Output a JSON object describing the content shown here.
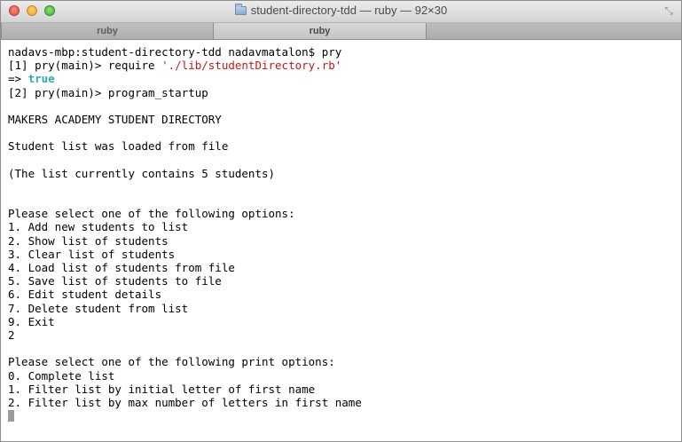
{
  "window": {
    "title": "student-directory-tdd — ruby — 92×30",
    "tabs": [
      {
        "label": "ruby"
      },
      {
        "label": "ruby"
      }
    ]
  },
  "terminal": {
    "lines": [
      {
        "parts": [
          {
            "text": "nadavs-mbp:student-directory-tdd nadavmatalon$ pry",
            "style": "normal"
          }
        ]
      },
      {
        "parts": [
          {
            "text": "[1] pry(main)> require ",
            "style": "normal"
          },
          {
            "text": "'./lib/studentDirectory.rb'",
            "style": "string"
          }
        ]
      },
      {
        "parts": [
          {
            "text": "=> ",
            "style": "normal"
          },
          {
            "text": "true",
            "style": "bool"
          }
        ]
      },
      {
        "parts": [
          {
            "text": "[2] pry(main)> program_startup",
            "style": "normal"
          }
        ]
      },
      {
        "parts": [
          {
            "text": "",
            "style": "normal"
          }
        ]
      },
      {
        "parts": [
          {
            "text": "MAKERS ACADEMY STUDENT DIRECTORY",
            "style": "normal"
          }
        ]
      },
      {
        "parts": [
          {
            "text": "",
            "style": "normal"
          }
        ]
      },
      {
        "parts": [
          {
            "text": "Student list was loaded from file",
            "style": "normal"
          }
        ]
      },
      {
        "parts": [
          {
            "text": "",
            "style": "normal"
          }
        ]
      },
      {
        "parts": [
          {
            "text": "(The list currently contains 5 students)",
            "style": "normal"
          }
        ]
      },
      {
        "parts": [
          {
            "text": "",
            "style": "normal"
          }
        ]
      },
      {
        "parts": [
          {
            "text": "",
            "style": "normal"
          }
        ]
      },
      {
        "parts": [
          {
            "text": "Please select one of the following options:",
            "style": "normal"
          }
        ]
      },
      {
        "parts": [
          {
            "text": "1. Add new students to list",
            "style": "normal"
          }
        ]
      },
      {
        "parts": [
          {
            "text": "2. Show list of students",
            "style": "normal"
          }
        ]
      },
      {
        "parts": [
          {
            "text": "3. Clear list of students",
            "style": "normal"
          }
        ]
      },
      {
        "parts": [
          {
            "text": "4. Load list of students from file",
            "style": "normal"
          }
        ]
      },
      {
        "parts": [
          {
            "text": "5. Save list of students to file",
            "style": "normal"
          }
        ]
      },
      {
        "parts": [
          {
            "text": "6. Edit student details",
            "style": "normal"
          }
        ]
      },
      {
        "parts": [
          {
            "text": "7. Delete student from list",
            "style": "normal"
          }
        ]
      },
      {
        "parts": [
          {
            "text": "9. Exit",
            "style": "normal"
          }
        ]
      },
      {
        "parts": [
          {
            "text": "2",
            "style": "normal"
          }
        ]
      },
      {
        "parts": [
          {
            "text": "",
            "style": "normal"
          }
        ]
      },
      {
        "parts": [
          {
            "text": "Please select one of the following print options:",
            "style": "normal"
          }
        ]
      },
      {
        "parts": [
          {
            "text": "0. Complete list",
            "style": "normal"
          }
        ]
      },
      {
        "parts": [
          {
            "text": "1. Filter list by initial letter of first name",
            "style": "normal"
          }
        ]
      },
      {
        "parts": [
          {
            "text": "2. Filter list by max number of letters in first name",
            "style": "normal"
          }
        ]
      }
    ],
    "colors": {
      "string": "#c41a16",
      "bool": "#2eaab5",
      "cursor": "#9b9b9b"
    }
  },
  "icons": {
    "close": "close-icon",
    "minimize": "minimize-icon",
    "maximize": "maximize-icon",
    "folder": "folder-icon",
    "fullscreen": "fullscreen-icon"
  }
}
